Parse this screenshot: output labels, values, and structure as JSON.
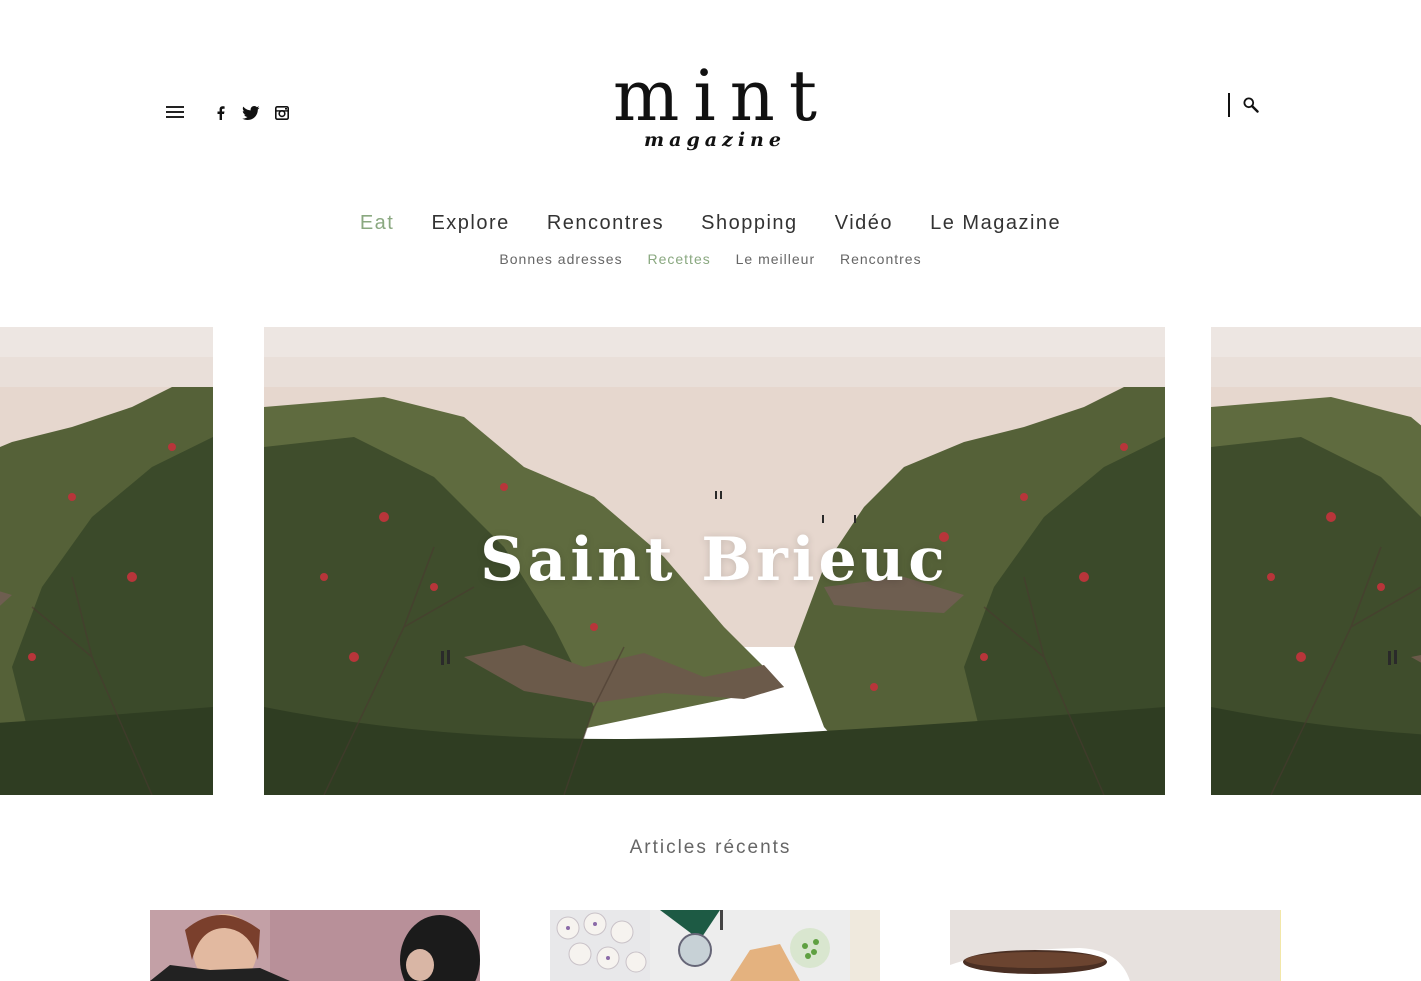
{
  "header": {
    "logo_title": "mint",
    "logo_subtitle": "magazine",
    "social_icons": [
      "facebook-icon",
      "twitter-icon",
      "instagram-icon"
    ]
  },
  "nav": {
    "main": [
      {
        "label": "Eat",
        "active": true
      },
      {
        "label": "Explore",
        "active": false
      },
      {
        "label": "Rencontres",
        "active": false
      },
      {
        "label": "Shopping",
        "active": false
      },
      {
        "label": "Vidéo",
        "active": false
      },
      {
        "label": "Le Magazine",
        "active": false
      }
    ],
    "sub": [
      {
        "label": "Bonnes adresses",
        "active": false
      },
      {
        "label": "Recettes",
        "active": true
      },
      {
        "label": "Le meilleur",
        "active": false
      },
      {
        "label": "Rencontres",
        "active": false
      }
    ]
  },
  "hero": {
    "title": "Saint Brieuc"
  },
  "recent": {
    "title": "Articles récents"
  },
  "colors": {
    "accent": "#8aa880",
    "text": "#2b2b2b"
  }
}
